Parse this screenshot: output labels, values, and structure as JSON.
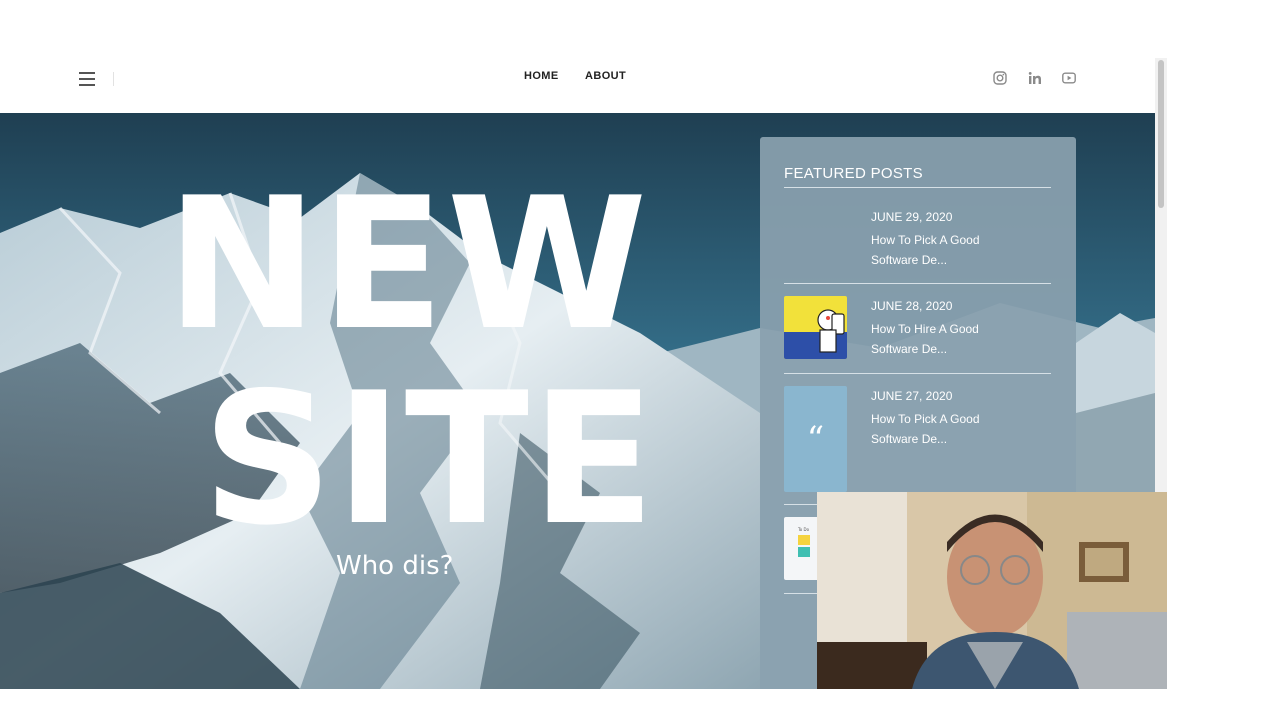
{
  "header": {
    "nav": [
      {
        "label": "HOME"
      },
      {
        "label": "ABOUT"
      }
    ],
    "social_icons": [
      "instagram-icon",
      "linkedin-icon",
      "youtube-icon"
    ]
  },
  "hero": {
    "line1": "NEW",
    "line2": "SITE",
    "subtitle": "Who dis?"
  },
  "featured": {
    "title": "FEATURED POSTS",
    "posts": [
      {
        "date": "JUNE 29, 2020",
        "title": "How To Pick A Good Software De..."
      },
      {
        "date": "JUNE 28, 2020",
        "title": "How To Hire A Good Software De..."
      },
      {
        "date": "JUNE 27, 2020",
        "title": "How To Pick A Good Software De..."
      }
    ],
    "quote_glyph": "“",
    "thumb4_label": "To Do"
  },
  "colors": {
    "panel": "#8aa0ae",
    "sky": "#35708b",
    "snow": "#dfe9ee",
    "thumb_yellow": "#f2e13a",
    "thumb_blue": "#8ab6cf"
  }
}
